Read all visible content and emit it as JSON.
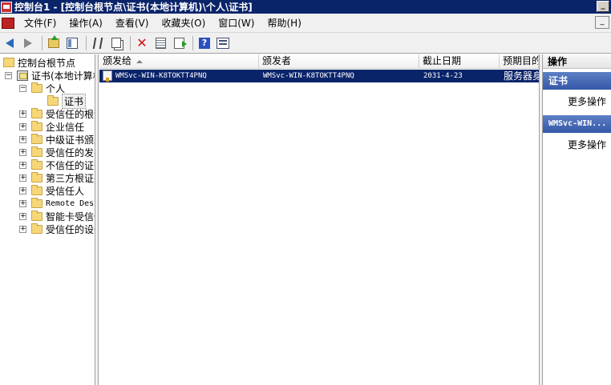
{
  "window": {
    "title": "控制台1 - [控制台根节点\\证书(本地计算机)\\个人\\证书]",
    "minimize_glyph": "_"
  },
  "menu": {
    "items": [
      "文件(F)",
      "操作(A)",
      "查看(V)",
      "收藏夹(O)",
      "窗口(W)",
      "帮助(H)"
    ],
    "mdi_glyph": "_"
  },
  "toolbar": {
    "icons": [
      "back-icon",
      "forward-icon",
      "up-folder-icon",
      "show-tree-icon",
      "cut-icon",
      "copy-icon",
      "delete-icon",
      "properties-icon",
      "export-icon",
      "help-icon",
      "mmc-view-icon"
    ]
  },
  "tree": {
    "root": "控制台根节点",
    "store": "证书(本地计算机)",
    "personal": "个人",
    "certs": "证书",
    "stores": [
      "受信任的根证书颁发机构",
      "企业信任",
      "中级证书颁发机构",
      "受信任的发布者",
      "不信任的证书",
      "第三方根证书颁发机构",
      "受信任人",
      "Remote Desktop",
      "智能卡受信任的根",
      "受信任的设备"
    ],
    "expand_glyph": "+",
    "collapse_glyph": "−"
  },
  "list": {
    "columns": [
      "颁发给",
      "颁发者",
      "截止日期",
      "预期目的"
    ],
    "rows": [
      {
        "issued_to": "WMSvc-WIN-K8TOKTT4PNQ",
        "issued_by": "WMSvc-WIN-K8TOKTT4PNQ",
        "expiry": "2031-4-23",
        "purpose": "服务器身份验证"
      }
    ]
  },
  "actions": {
    "title": "操作",
    "section1": "证书",
    "more1": "更多操作",
    "section2": "WMSvc-WIN...",
    "more2": "更多操作",
    "accent": "#3558a8"
  }
}
